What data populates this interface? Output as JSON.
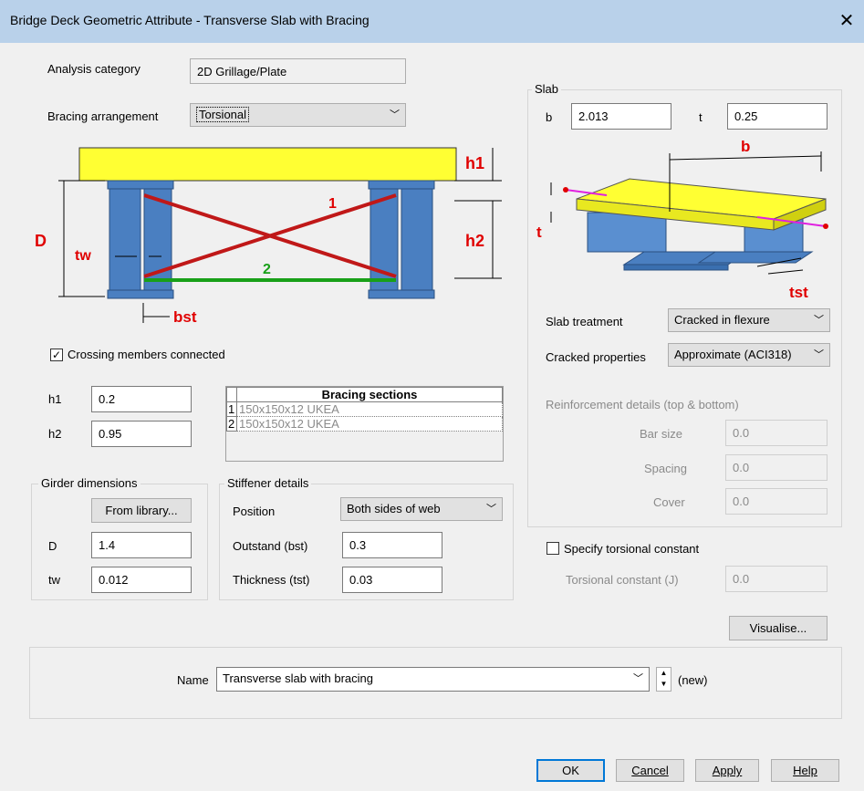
{
  "window": {
    "title": "Bridge Deck Geometric Attribute - Transverse Slab with Bracing",
    "close_glyph": "✕"
  },
  "analysis_category": {
    "label": "Analysis category",
    "value": "2D Grillage/Plate"
  },
  "bracing_arrangement": {
    "label": "Bracing arrangement",
    "value": "Torsional"
  },
  "bracing_diagram": {
    "h1": "h1",
    "h2": "h2",
    "D": "D",
    "tw": "tw",
    "bst": "bst",
    "member1": "1",
    "member2": "2"
  },
  "crossing": {
    "label": "Crossing members connected",
    "checked": true
  },
  "h1": {
    "label": "h1",
    "value": "0.2"
  },
  "h2": {
    "label": "h2",
    "value": "0.95"
  },
  "bracing_sections": {
    "header": "Bracing sections",
    "rows": [
      {
        "num": "1",
        "name": "150x150x12 UKEA"
      },
      {
        "num": "2",
        "name": "150x150x12 UKEA"
      }
    ]
  },
  "girder": {
    "title": "Girder dimensions",
    "from_library": "From library...",
    "D_label": "D",
    "D_value": "1.4",
    "tw_label": "tw",
    "tw_value": "0.012"
  },
  "stiffener": {
    "title": "Stiffener details",
    "position_label": "Position",
    "position_value": "Both sides of web",
    "outstand_label": "Outstand (bst)",
    "outstand_value": "0.3",
    "thickness_label": "Thickness (tst)",
    "thickness_value": "0.03"
  },
  "slab": {
    "title": "Slab",
    "b_label": "b",
    "b_value": "2.013",
    "t_label": "t",
    "t_value": "0.25",
    "diagram": {
      "b": "b",
      "t": "t",
      "tst": "tst"
    },
    "treatment_label": "Slab treatment",
    "treatment_value": "Cracked in flexure",
    "cracked_label": "Cracked properties",
    "cracked_value": "Approximate (ACI318)",
    "reinf_title": "Reinforcement details (top & bottom)",
    "bar_size_label": "Bar size",
    "bar_size_value": "0.0",
    "spacing_label": "Spacing",
    "spacing_value": "0.0",
    "cover_label": "Cover",
    "cover_value": "0.0"
  },
  "torsional": {
    "checkbox_label": "Specify torsional constant",
    "checked": false,
    "label": "Torsional constant (J)",
    "value": "0.0"
  },
  "visualise": "Visualise...",
  "name": {
    "label": "Name",
    "value": "Transverse slab with bracing",
    "status": "(new)"
  },
  "buttons": {
    "ok": "OK",
    "cancel": "Cancel",
    "apply": "Apply",
    "help": "Help"
  },
  "colors": {
    "title_bar": "#b9d1ea",
    "deck_yellow": "#ffff33",
    "steel_blue": "#4a7fc1",
    "bracing_red": "#e02020",
    "bracing_green": "#20b020",
    "label_red": "#e00000",
    "focus_blue": "#0078d7"
  }
}
